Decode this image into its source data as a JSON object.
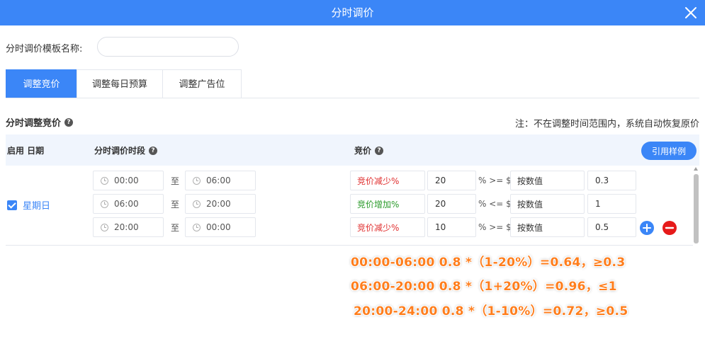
{
  "dialog": {
    "title": "分时调价",
    "accent_color": "#3b86f7"
  },
  "template_name": {
    "label": "分时调价模板名称:",
    "value": "",
    "placeholder": ""
  },
  "tabs": [
    {
      "label": "调整竞价",
      "active": true
    },
    {
      "label": "调整每日预算",
      "active": false
    },
    {
      "label": "调整广告位",
      "active": false
    }
  ],
  "section": {
    "title": "分时调整竞价",
    "note": "注：不在调整时间范围内，系统自动恢复原价"
  },
  "table": {
    "headers": {
      "enable_day": "启用 日期",
      "time_range": "分时调价时段",
      "bid": "竞价"
    },
    "sample_button": "引用样例",
    "day": "星期日",
    "day_enabled": true,
    "separator": "至",
    "rows": [
      {
        "start": "00:00",
        "end": "06:00",
        "adjust": "竞价减少%",
        "adjust_color": "#e03030",
        "percent": "20",
        "op": "% >= $",
        "mode": "按数值",
        "limit": "0.3"
      },
      {
        "start": "06:00",
        "end": "20:00",
        "adjust": "竞价增加%",
        "adjust_color": "#2a9a2a",
        "percent": "20",
        "op": "% <= $",
        "mode": "按数值",
        "limit": "1"
      },
      {
        "start": "20:00",
        "end": "00:00",
        "adjust": "竞价减少%",
        "adjust_color": "#e03030",
        "percent": "10",
        "op": "% >= $",
        "mode": "按数值",
        "limit": "0.5"
      }
    ]
  },
  "annotations": [
    "00:00-06:00  0.8 *（1-20%）=0.64，≥0.3",
    "06:00-20:00  0.8 *（1+20%）=0.96，≤1",
    "20:00-24:00  0.8 *（1-10%）=0.72，≥0.5"
  ],
  "icons": {
    "close": "close-icon",
    "help": "question-icon",
    "clock": "clock-icon",
    "add": "plus-circle-icon",
    "remove": "minus-circle-icon"
  }
}
